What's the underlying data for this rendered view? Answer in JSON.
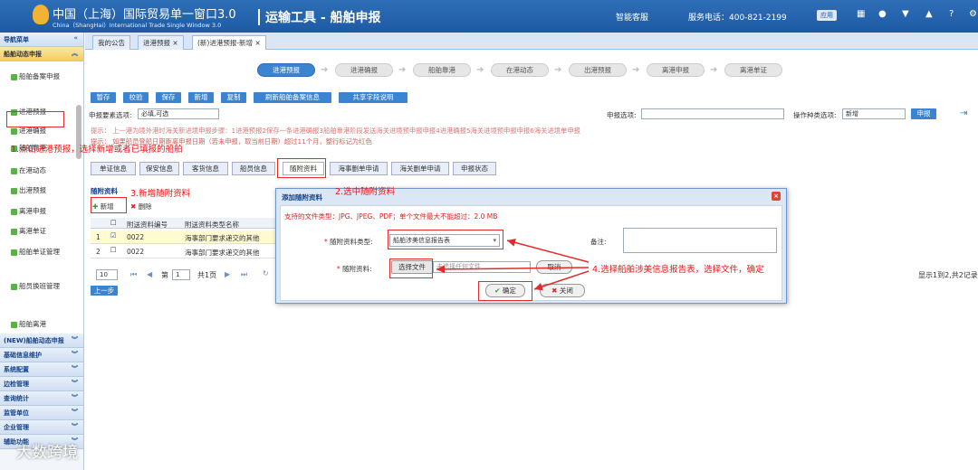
{
  "header": {
    "brand_cn": "中国（上海）国际贸易单一窗口3.0",
    "brand_en": "China（ShangHai）International Trade Single Window 3.0",
    "system": "运输工具 - 船舶申报",
    "service": "智能客服",
    "phone": "服务电话：400-821-2199",
    "apps": "应用"
  },
  "sidebar": {
    "nav_title": "导航菜单",
    "group": "船舶动态申报",
    "items": [
      "船舶备案申报",
      "进港预报",
      "进港确报",
      "船舶靠港",
      "在港动态",
      "出港预报",
      "离港申报",
      "离港单证",
      "船舶单证管理",
      "船员换班管理",
      "船舶离港"
    ],
    "sections": [
      "(NEW)船舶动态申报",
      "基础信息维护",
      "系统配置",
      "边检管理",
      "查询统计",
      "监管单位",
      "企业管理",
      "辅助功能"
    ]
  },
  "tabs": [
    "我的公告",
    "进港预报",
    "(新)进港预报-新增"
  ],
  "steps": [
    "进港预报",
    "进港确报",
    "船舶靠港",
    "在港动态",
    "出港预报",
    "离港申报",
    "离港单证"
  ],
  "toolbar": [
    "暂存",
    "校验",
    "保存",
    "新增",
    "复制",
    "刷新船舶备案信息",
    "共享字段说明"
  ],
  "form": {
    "required_label": "申报要素选项:",
    "required_value": "必填,可选",
    "declare_label": "申报选项:",
    "op_label": "操作种类选项:",
    "op_value": "新增",
    "declare_btn": "申报"
  },
  "tips": [
    "提示：  上一港为境外港时海关新进境申报步骤：1进港预报2保存一条进港确报3船舶靠港阶段发送海关进境预申报申报4进港确报5海关进境预申报申报6海关进境单申报",
    "提示：  如果船员登船日期距离申报日期（若未申报，取当前日期）超过11个月，整行标记为红色"
  ],
  "subtabs": [
    "单证信息",
    "保安信息",
    "客货信息",
    "船员信息",
    "随附资料",
    "海事删单申请",
    "海关删单申请",
    "申报状态"
  ],
  "grid": {
    "title": "随附资料",
    "add": "新增",
    "del": "删除",
    "headers": [
      "附送资料编号",
      "附送资料类型名称"
    ],
    "rows": [
      {
        "n": "1",
        "code": "0022",
        "name": "海事部门要求递交的其他",
        "checked": true
      },
      {
        "n": "2",
        "code": "0022",
        "name": "海事部门要求递交的其他",
        "checked": false
      }
    ],
    "pager": {
      "size": "10",
      "page": "1",
      "total": "共1页"
    },
    "prev": "上一步",
    "summary": "显示1到2,共2记录"
  },
  "dialog": {
    "title": "添加随附资料",
    "types": "支持的文件类型：JPG、JPEG、PDF；单个文件最大不能超过：2.0 MB",
    "type_label": "随附资料类型:",
    "type_value": "船舶涉美信息报告表",
    "remark_label": "备注:",
    "file_label": "随附资料:",
    "choose": "选择文件",
    "nofile": "未选择任何文件",
    "cancel": "取消",
    "ok": "确定",
    "close": "关闭"
  },
  "annotations": [
    "1.点击进港预报，选择新增或者已填报的船舶",
    "2.选中随附资料",
    "3.新增随附资料",
    "4.选择船舶涉美信息报告表，选择文件，确定"
  ],
  "watermark": "大数跨境"
}
